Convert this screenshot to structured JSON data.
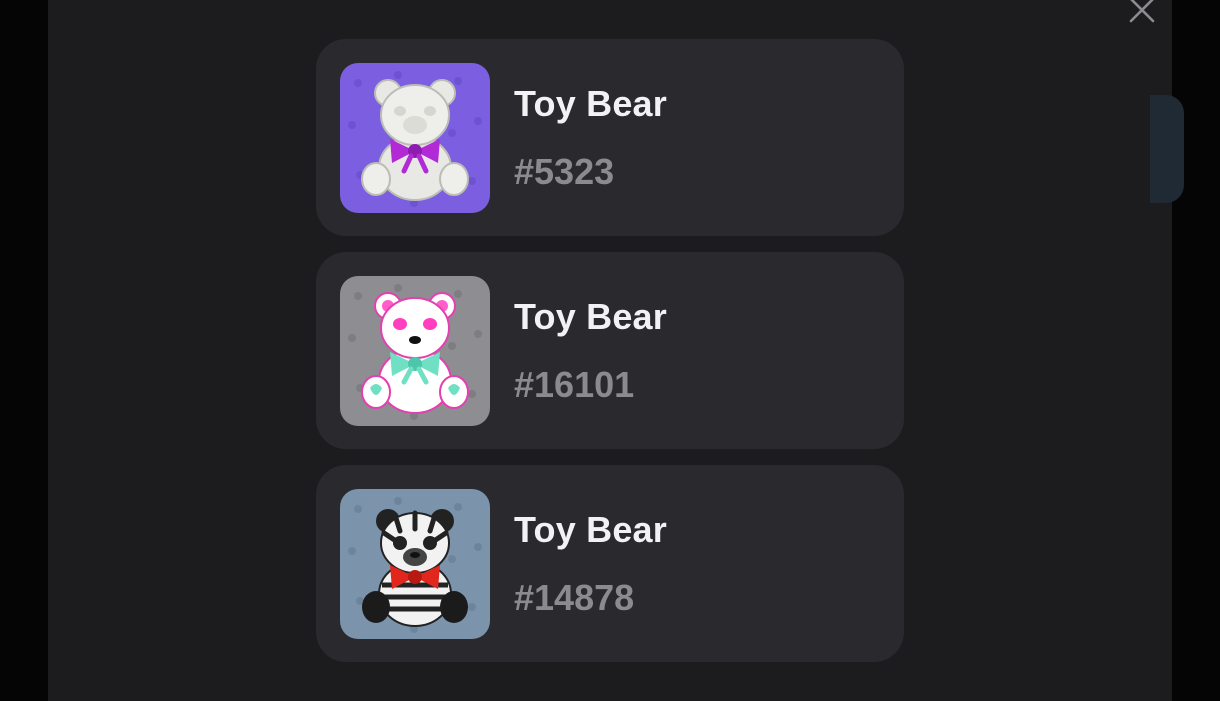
{
  "modal": {
    "close_icon": "close-icon",
    "items": [
      {
        "name": "Toy Bear",
        "number": "#5323",
        "image": "bear-white-purple-bow",
        "bg_color": "#7c5fe0",
        "body_color": "#e8e8e4",
        "bow_color": "#b12ad6",
        "ear_inner": "#d9d9d4"
      },
      {
        "name": "Toy Bear",
        "number": "#16101",
        "image": "bear-pink-mint-bow",
        "bg_color": "#8d8d92",
        "body_color": "#ffffff",
        "bow_color": "#6fe0c4",
        "ear_inner": "#ff5fc8"
      },
      {
        "name": "Toy Bear",
        "number": "#14878",
        "image": "bear-zebra-red-bow",
        "bg_color": "#7b93ab",
        "body_color": "#f2f2f2",
        "bow_color": "#e0261d",
        "ear_inner": "#222222"
      }
    ]
  }
}
